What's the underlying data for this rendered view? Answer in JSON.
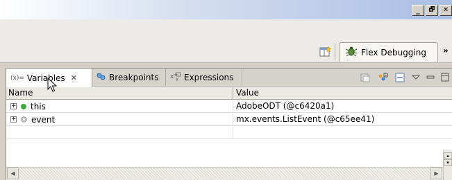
{
  "window": {
    "buttons": [
      {
        "name": "minimize",
        "glyph": "_"
      },
      {
        "name": "restore",
        "glyph": "🗗"
      },
      {
        "name": "close",
        "glyph": "✕"
      }
    ]
  },
  "perspectives": {
    "active": {
      "label": "Flex Debugging",
      "icon": "flex-debug-bug-icon"
    },
    "more_glyph": "»",
    "open_perspective_icon": "open-perspective-icon"
  },
  "view": {
    "tabs": [
      {
        "label": "Variables",
        "icon": "variables-icon",
        "glyph": "(x)=",
        "active": true,
        "close_glyph": "✕"
      },
      {
        "label": "Breakpoints",
        "icon": "breakpoints-icon",
        "active": false
      },
      {
        "label": "Expressions",
        "icon": "expressions-icon",
        "active": false
      }
    ],
    "toolbar": [
      {
        "name": "show-type-names-icon"
      },
      {
        "name": "collapse-all-icon"
      },
      {
        "name": "view-menu-icon"
      },
      {
        "name": "minimize-view-icon"
      },
      {
        "name": "maximize-view-icon"
      }
    ],
    "table": {
      "columns": [
        "Name",
        "Value"
      ],
      "rows": [
        {
          "expander": "+",
          "status_color": "#3caa3c",
          "name": "this",
          "value": "AdobeODT (@c6420a1)"
        },
        {
          "expander": "+",
          "status_color": "#9a9a9a",
          "name": "event",
          "value": "mx.events.ListEvent (@c65ee41)"
        }
      ]
    }
  }
}
